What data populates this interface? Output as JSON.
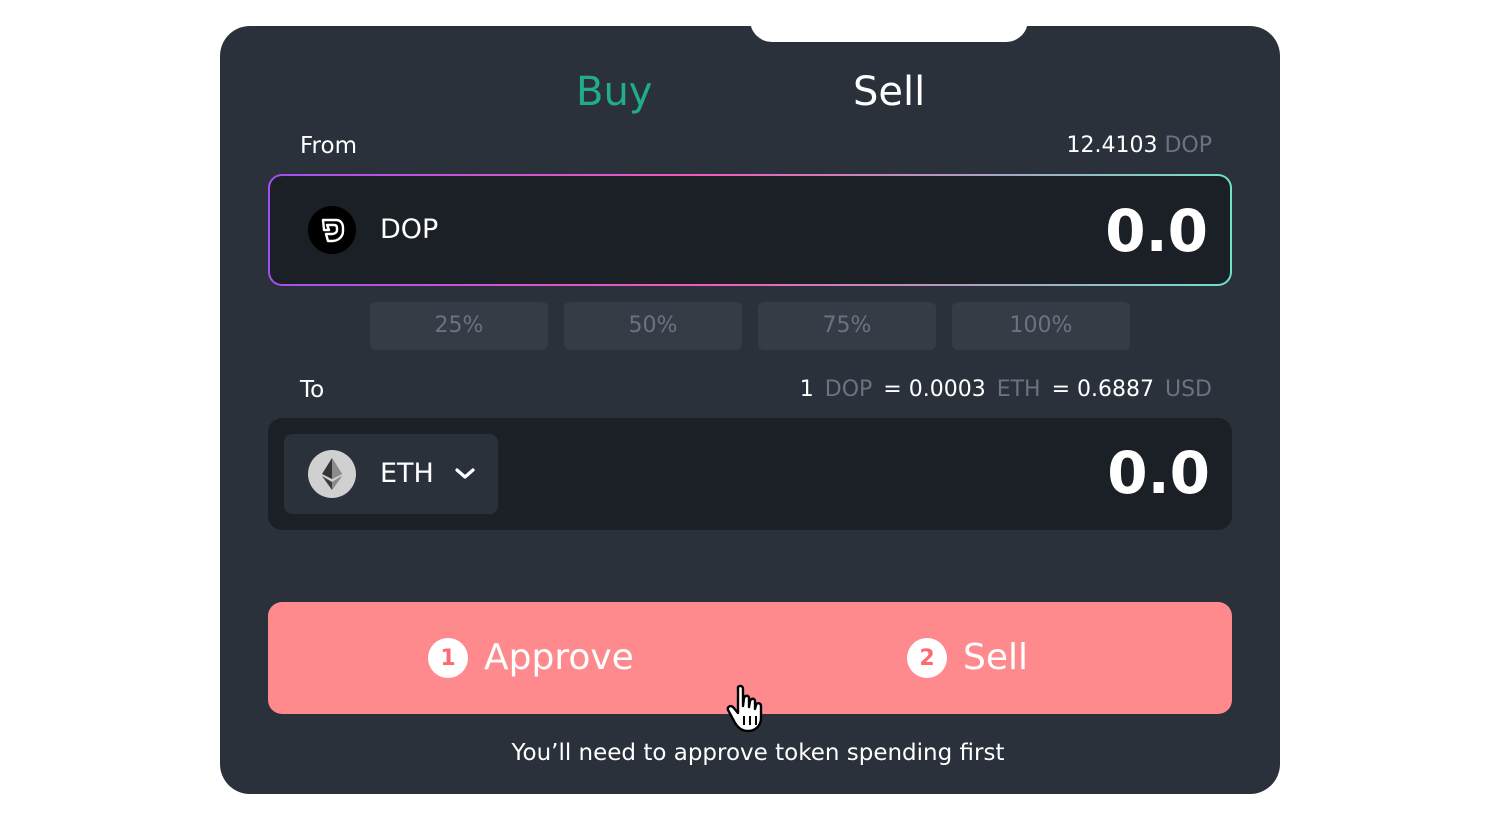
{
  "tabs": {
    "buy_label": "Buy",
    "sell_label": "Sell",
    "active": "Buy"
  },
  "from": {
    "label": "From",
    "balance_value": "12.4103",
    "balance_unit": "DOP",
    "token": "DOP",
    "amount": "0.0"
  },
  "percent_buttons": [
    "25%",
    "50%",
    "75%",
    "100%"
  ],
  "to": {
    "label": "To",
    "token": "ETH",
    "amount": "0.0"
  },
  "rate": {
    "base_amount": "1",
    "base_unit": "DOP",
    "eth_value": "= 0.0003",
    "eth_unit": "ETH",
    "usd_value": "= 0.6887",
    "usd_unit": "USD"
  },
  "actions": {
    "step1_number": "1",
    "step1_label": "Approve",
    "step2_number": "2",
    "step2_label": "Sell"
  },
  "hint": "You’ll need to approve token spending first",
  "colors": {
    "accent_green": "#1fae86",
    "button_pink": "#ff8a8e",
    "card_bg": "#2a313b",
    "field_bg": "#1b1f26"
  },
  "icons": {
    "from_token_icon": "dop-logo-icon",
    "to_token_icon": "ethereum-icon",
    "dropdown_icon": "chevron-down-icon",
    "cursor": "hand-pointer-icon"
  }
}
